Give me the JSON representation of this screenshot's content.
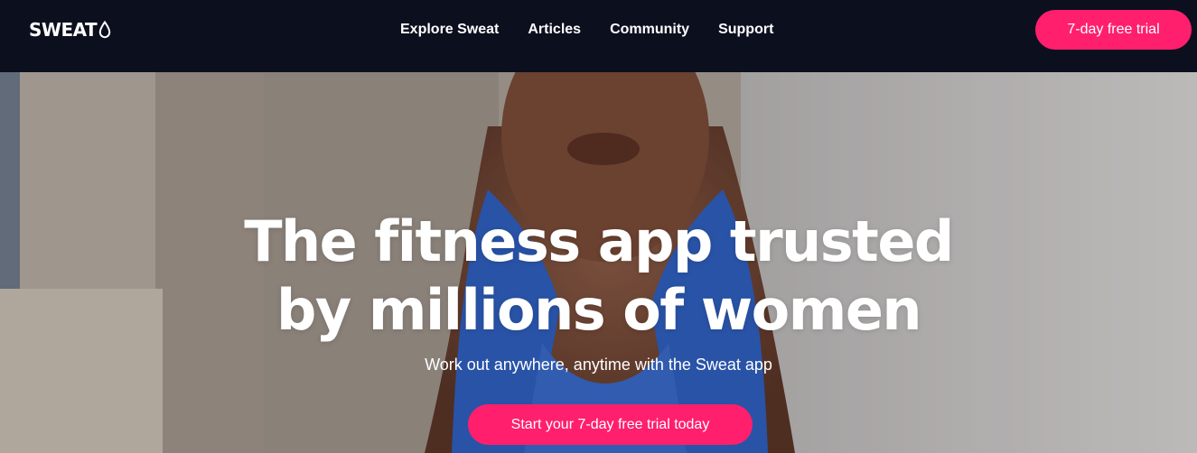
{
  "header": {
    "logo_text": "SWEAT",
    "logo_icon": "water-drop-icon",
    "nav": [
      {
        "label": "Explore Sweat"
      },
      {
        "label": "Articles"
      },
      {
        "label": "Community"
      },
      {
        "label": "Support"
      }
    ],
    "cta_label": "7-day free trial"
  },
  "hero": {
    "title_line1": "The fitness app trusted",
    "title_line2": "by millions of women",
    "subtitle": "Work out anywhere, anytime with the Sweat app",
    "cta_label": "Start your 7-day free trial today"
  },
  "colors": {
    "nav_background": "#0c0f1e",
    "accent": "#ff1f6d",
    "text": "#ffffff"
  }
}
